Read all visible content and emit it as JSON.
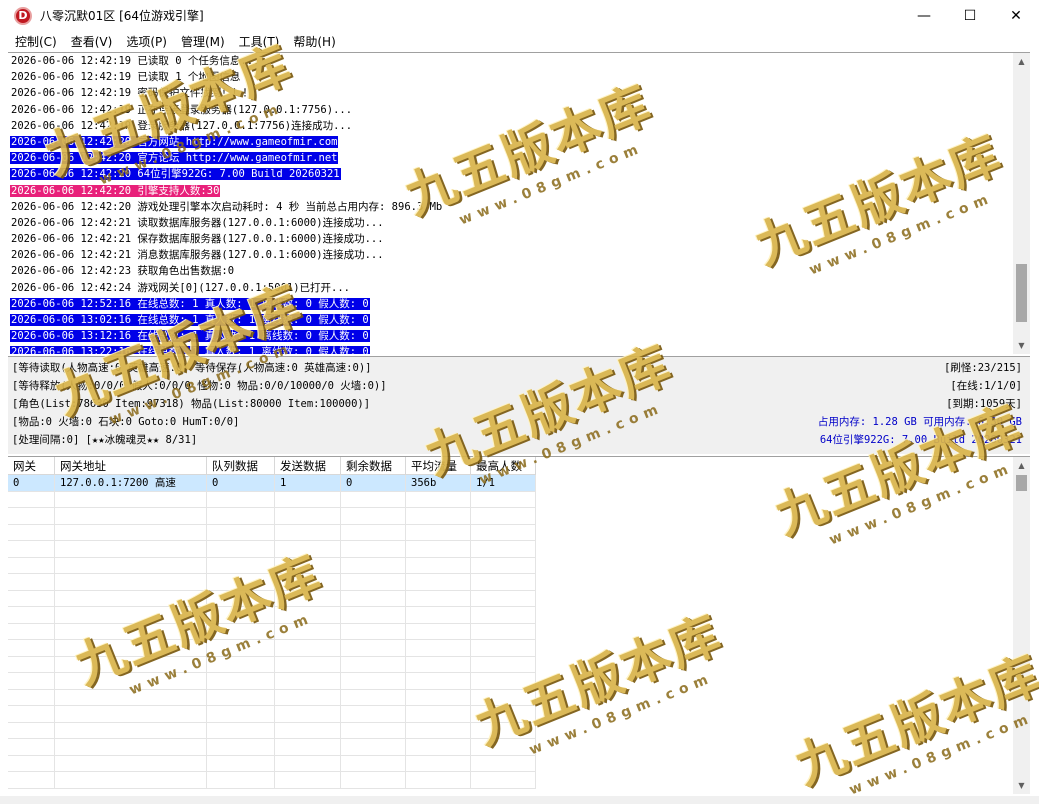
{
  "window": {
    "icon_letter": "D",
    "title": "八零沉默01区 [64位游戏引擎]",
    "minimize": "—",
    "maximize": "☐",
    "close": "✕"
  },
  "menu": [
    {
      "label": "控制(C)"
    },
    {
      "label": "查看(V)"
    },
    {
      "label": "选项(P)"
    },
    {
      "label": "管理(M)"
    },
    {
      "label": "工具(T)"
    },
    {
      "label": "帮助(H)"
    }
  ],
  "log": [
    {
      "text": "2026-06-06 12:42:19 已读取 0 个任务信息...",
      "style": ""
    },
    {
      "text": "2026-06-06 12:42:19 已读取 1 个地图信息",
      "style": ""
    },
    {
      "text": "2026-06-06 12:42:19 密码保护文件找到！！！",
      "style": ""
    },
    {
      "text": "2026-06-06 12:42:19 正在连接登录服务器(127.0.0.1:7756)...",
      "style": ""
    },
    {
      "text": "2026-06-06 12:42:19 登录服务器(127.0.0.1:7756)连接成功...",
      "style": ""
    },
    {
      "text": "2026-06-06 12:42:20 官方网站 http://www.gameofmir.com",
      "style": "blue"
    },
    {
      "text": "2026-06-06 12:42:20 官方论坛 http://www.gameofmir.net",
      "style": "blue"
    },
    {
      "text": "2026-06-06 12:42:20 64位引擎922G: 7.00 Build 20260321",
      "style": "blue"
    },
    {
      "text": "2026-06-06 12:42:20 引擎支持人数:30",
      "style": "pink"
    },
    {
      "text": "2026-06-06 12:42:20 游戏处理引擎本次启动耗时: 4 秒 当前总占用内存: 896.3 Mb",
      "style": ""
    },
    {
      "text": "2026-06-06 12:42:21 读取数据库服务器(127.0.0.1:6000)连接成功...",
      "style": ""
    },
    {
      "text": "2026-06-06 12:42:21 保存数据库服务器(127.0.0.1:6000)连接成功...",
      "style": ""
    },
    {
      "text": "2026-06-06 12:42:21 消息数据库服务器(127.0.0.1:6000)连接成功...",
      "style": ""
    },
    {
      "text": "2026-06-06 12:42:23 获取角色出售数据:0",
      "style": ""
    },
    {
      "text": "2026-06-06 12:42:24 游戏网关[0](127.0.0.1:5001)已打开...",
      "style": ""
    },
    {
      "text": "2026-06-06 12:52:16 在线总数: 1 真人数: 1 离线数: 0 假人数: 0",
      "style": "blue"
    },
    {
      "text": "2026-06-06 13:02:16 在线总数: 1 真人数: 1 离线数: 0 假人数: 0",
      "style": "blue"
    },
    {
      "text": "2026-06-06 13:12:16 在线总数: 1 真人数: 1 离线数: 0 假人数: 0",
      "style": "blue"
    },
    {
      "text": "2026-06-06 13:22:16 在线总数: 1 真人数: 1 离线数: 0 假人数: 0",
      "style": "blue"
    }
  ],
  "status": {
    "row1_left": "[等待读取(人物高速:0 英雄高速:0) 等待保存(人物高速:0 英雄高速:0)]",
    "row2_left": "[等待释放(人物:0/0/0 假人:0/0/0 怪物:0 物品:0/0/10000/0 火墙:0)]",
    "row3_left": "[角色(List:78630 Item:97318) 物品(List:80000 Item:100000)]",
    "row4_left": "[物品:0 火墙:0 石块:0 Goto:0 HumT:0/0]",
    "row5_left": "[处理间隔:0]   [★★冰魄魂灵★★ 8/31]",
    "row1_right": "[刷怪:23/215]",
    "row2_right": "[在线:1/1/0]",
    "row3_right": "[到期:1059天]",
    "row4_right": "占用内存: 1.28 GB 可用内存: 6.30 GB",
    "row5_right": "64位引擎922G: 7.00 Build 20260321"
  },
  "grid": {
    "headers": [
      "网关",
      "网关地址",
      "队列数据",
      "发送数据",
      "剩余数据",
      "平均流量",
      "最高人数"
    ],
    "rows": [
      [
        "0",
        "127.0.0.1:7200 高速",
        "0",
        "1",
        "0",
        "356b",
        "1/1"
      ]
    ]
  },
  "watermark": {
    "big": "九五版本库",
    "small": "www.08gm.com"
  }
}
